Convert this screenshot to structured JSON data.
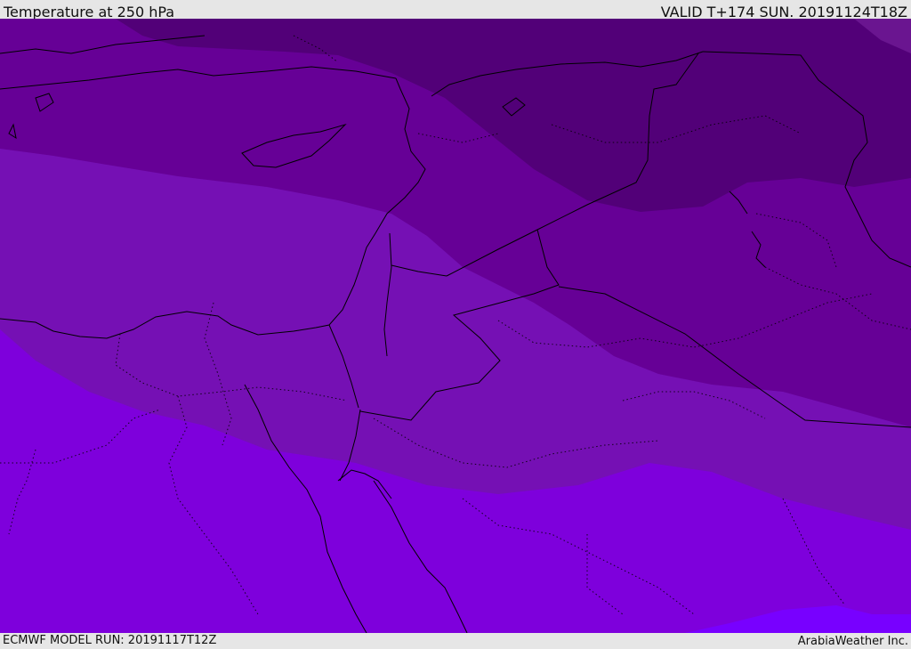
{
  "header": {
    "title": "Temperature at 250 hPa",
    "valid": "VALID T+174 SUN. 20191124T18Z"
  },
  "footer": {
    "model_run": "ECMWF MODEL RUN: 20191117T12Z",
    "credit": "ArabiaWeather Inc."
  },
  "map": {
    "field": "temperature",
    "level": "250 hPa",
    "region": "Eastern Mediterranean / Middle East",
    "band_colors": [
      "#520078",
      "#660096",
      "#7510b4",
      "#7e00dc",
      "#7800ff"
    ],
    "border_color": "#000000"
  }
}
